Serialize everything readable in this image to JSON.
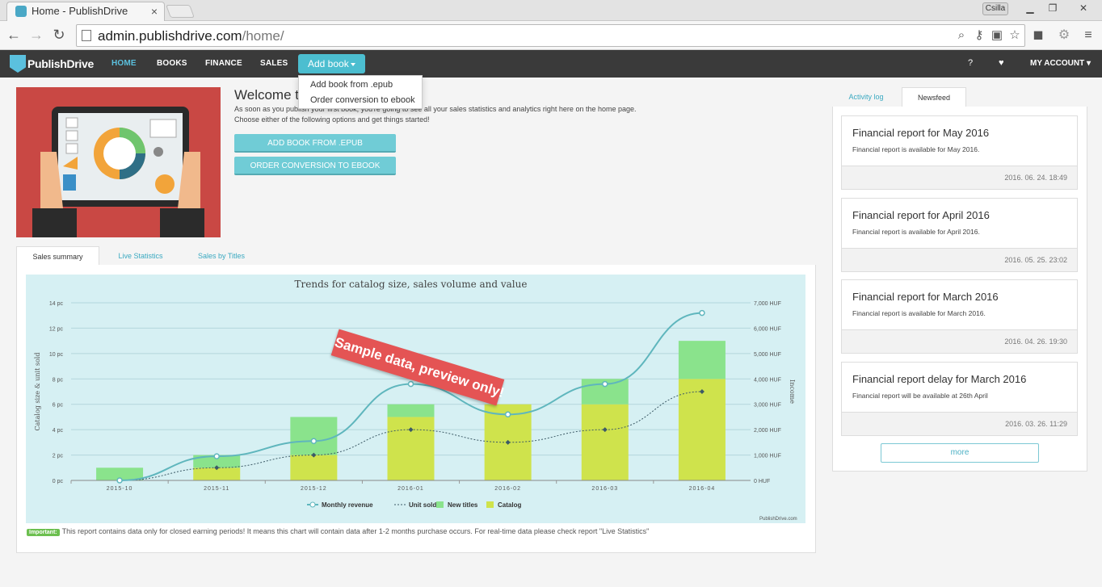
{
  "browser": {
    "tab_title": "Home - PublishDrive",
    "profile": "Csilla",
    "url_host": "admin.publishdrive.com",
    "url_path": "/home/"
  },
  "nav": {
    "logo": "PublishDrive",
    "items": [
      "HOME",
      "BOOKS",
      "FINANCE",
      "SALES"
    ],
    "add_book": "Add book",
    "account": "MY ACCOUNT",
    "dropdown": [
      "Add book from .epub",
      "Order conversion to ebook"
    ]
  },
  "welcome": {
    "title": "Welcome to",
    "line1": "As soon as you publish your first book, you're going to see all your sales statistics and analytics right here on the home page.",
    "line2": "Choose either of the following options and get things started!",
    "btn_epub": "ADD BOOK FROM .EPUB",
    "btn_conversion": "ORDER CONVERSION TO EBOOK"
  },
  "sales_tabs": [
    "Sales summary",
    "Live Statistics",
    "Sales by Titles"
  ],
  "chart_data": {
    "type": "bar",
    "title": "Trends for catalog size, sales volume and value",
    "ylabel": "Catalog size & unit sold",
    "y2label": "Income",
    "categories": [
      "2015-10",
      "2015-11",
      "2015-12",
      "2016-01",
      "2016-02",
      "2016-03",
      "2016-04"
    ],
    "ylim": [
      0,
      14
    ],
    "y2lim": [
      0,
      7000
    ],
    "yticks": [
      "0 pc",
      "2 pc",
      "4 pc",
      "6 pc",
      "8 pc",
      "10 pc",
      "12 pc",
      "14 pc"
    ],
    "y2ticks": [
      "0 HUF",
      "1,000 HUF",
      "2,000 HUF",
      "3,000 HUF",
      "4,000 HUF",
      "5,000 HUF",
      "6,000 HUF",
      "7,000 HUF"
    ],
    "series": [
      {
        "name": "Catalog",
        "kind": "bar",
        "color": "#cfe34c",
        "values": [
          0,
          1,
          2,
          5,
          6,
          6,
          8
        ]
      },
      {
        "name": "New titles",
        "kind": "bar",
        "color": "#8ae38c",
        "values": [
          1,
          1,
          3,
          1,
          0,
          2,
          3
        ]
      },
      {
        "name": "Monthly revenue",
        "kind": "line",
        "axis": "right",
        "color": "#5fb6bd",
        "values": [
          0,
          950,
          1550,
          3800,
          2600,
          3800,
          6600
        ]
      },
      {
        "name": "Unit sold",
        "kind": "line",
        "axis": "left",
        "color": "#3c5a66",
        "values": [
          0,
          1,
          2,
          4,
          3,
          4,
          7
        ]
      }
    ],
    "legend": [
      "Monthly revenue",
      "Unit sold",
      "New titles",
      "Catalog"
    ],
    "legend_position": "bottom",
    "overlay": "Sample data, preview only!",
    "credit": "PublishDrive.com"
  },
  "note": {
    "badge": "Important:",
    "text": "This report contains data only for closed earning periods! It means this chart will contain data after 1-2 months purchase occurs. For real-time data please check report \"Live Statistics\""
  },
  "side_tabs": [
    "Activity log",
    "Newsfeed"
  ],
  "news": [
    {
      "title": "Financial report for May 2016",
      "body": "Financial report is available for May 2016.",
      "date": "2016. 06. 24. 18:49"
    },
    {
      "title": "Financial report for April 2016",
      "body": "Financial report is available for April 2016.",
      "date": "2016. 05. 25. 23:02"
    },
    {
      "title": "Financial report for March 2016",
      "body": "Financial report is available for March 2016.",
      "date": "2016. 04. 26. 19:30"
    },
    {
      "title": "Financial report delay for March 2016",
      "body": "Financial report will be available at 26th April",
      "date": "2016. 03. 26. 11:29"
    }
  ],
  "more": "more"
}
